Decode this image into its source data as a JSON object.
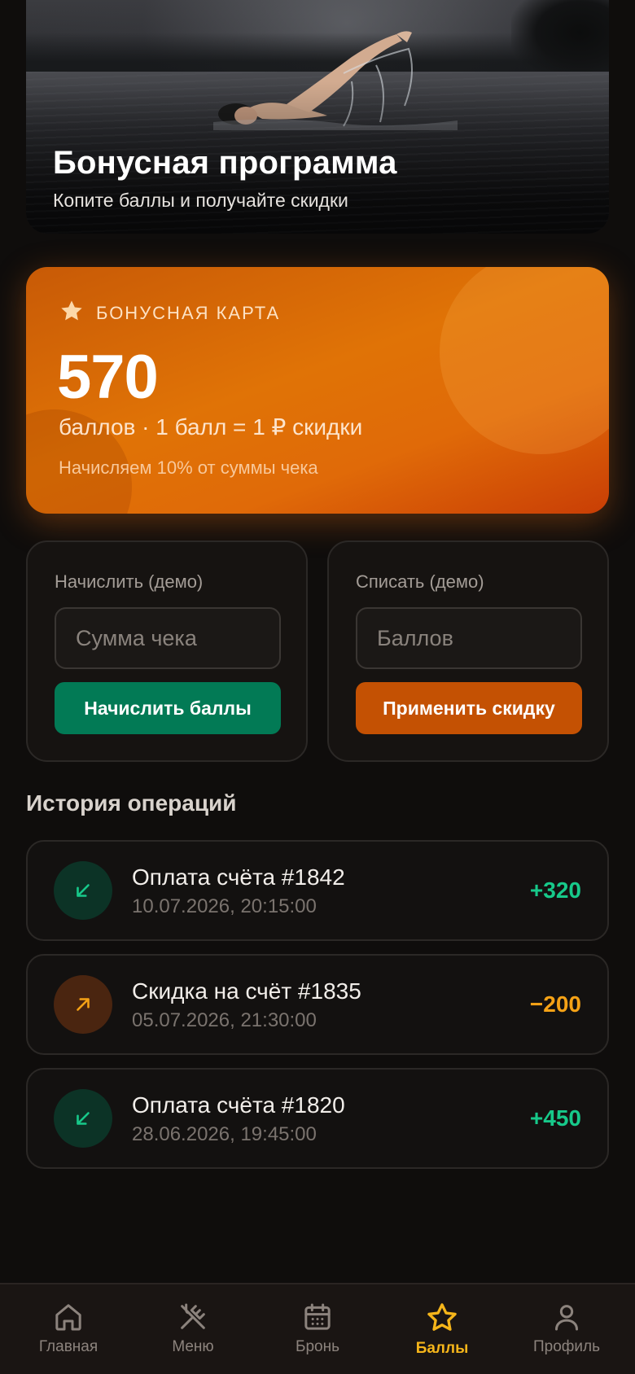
{
  "hero": {
    "title": "Бонусная программа",
    "subtitle": "Копите баллы и получайте скидки"
  },
  "bonus_card": {
    "label": "БОНУСНАЯ КАРТА",
    "points": "570",
    "rate": "баллов · 1 балл = 1 ₽ скидки",
    "note": "Начисляем 10% от суммы чека",
    "accent": "#e07306"
  },
  "accrue_panel": {
    "title": "Начислить (демо)",
    "input_placeholder": "Сумма чека",
    "button_label": "Начислить баллы"
  },
  "redeem_panel": {
    "title": "Списать (демо)",
    "input_placeholder": "Баллов",
    "button_label": "Применить скидку"
  },
  "history": {
    "title": "История операций",
    "items": [
      {
        "title": "Оплата счёта #1842",
        "date": "10.07.2026, 20:15:00",
        "amount": "+320",
        "type": "in"
      },
      {
        "title": "Скидка на счёт #1835",
        "date": "05.07.2026, 21:30:00",
        "amount": "−200",
        "type": "out"
      },
      {
        "title": "Оплата счёта #1820",
        "date": "28.06.2026, 19:45:00",
        "amount": "+450",
        "type": "in"
      }
    ]
  },
  "nav": {
    "items": [
      {
        "label": "Главная",
        "icon": "home-icon"
      },
      {
        "label": "Меню",
        "icon": "utensils-icon"
      },
      {
        "label": "Бронь",
        "icon": "calendar-icon"
      },
      {
        "label": "Баллы",
        "icon": "star-icon",
        "active": true
      },
      {
        "label": "Профиль",
        "icon": "user-icon"
      }
    ]
  },
  "colors": {
    "background": "#0f0d0c",
    "positive": "#17c98a",
    "negative": "#f5a216",
    "active_nav": "#f5b51a",
    "green_button": "#027a55",
    "orange_button": "#c45103"
  }
}
